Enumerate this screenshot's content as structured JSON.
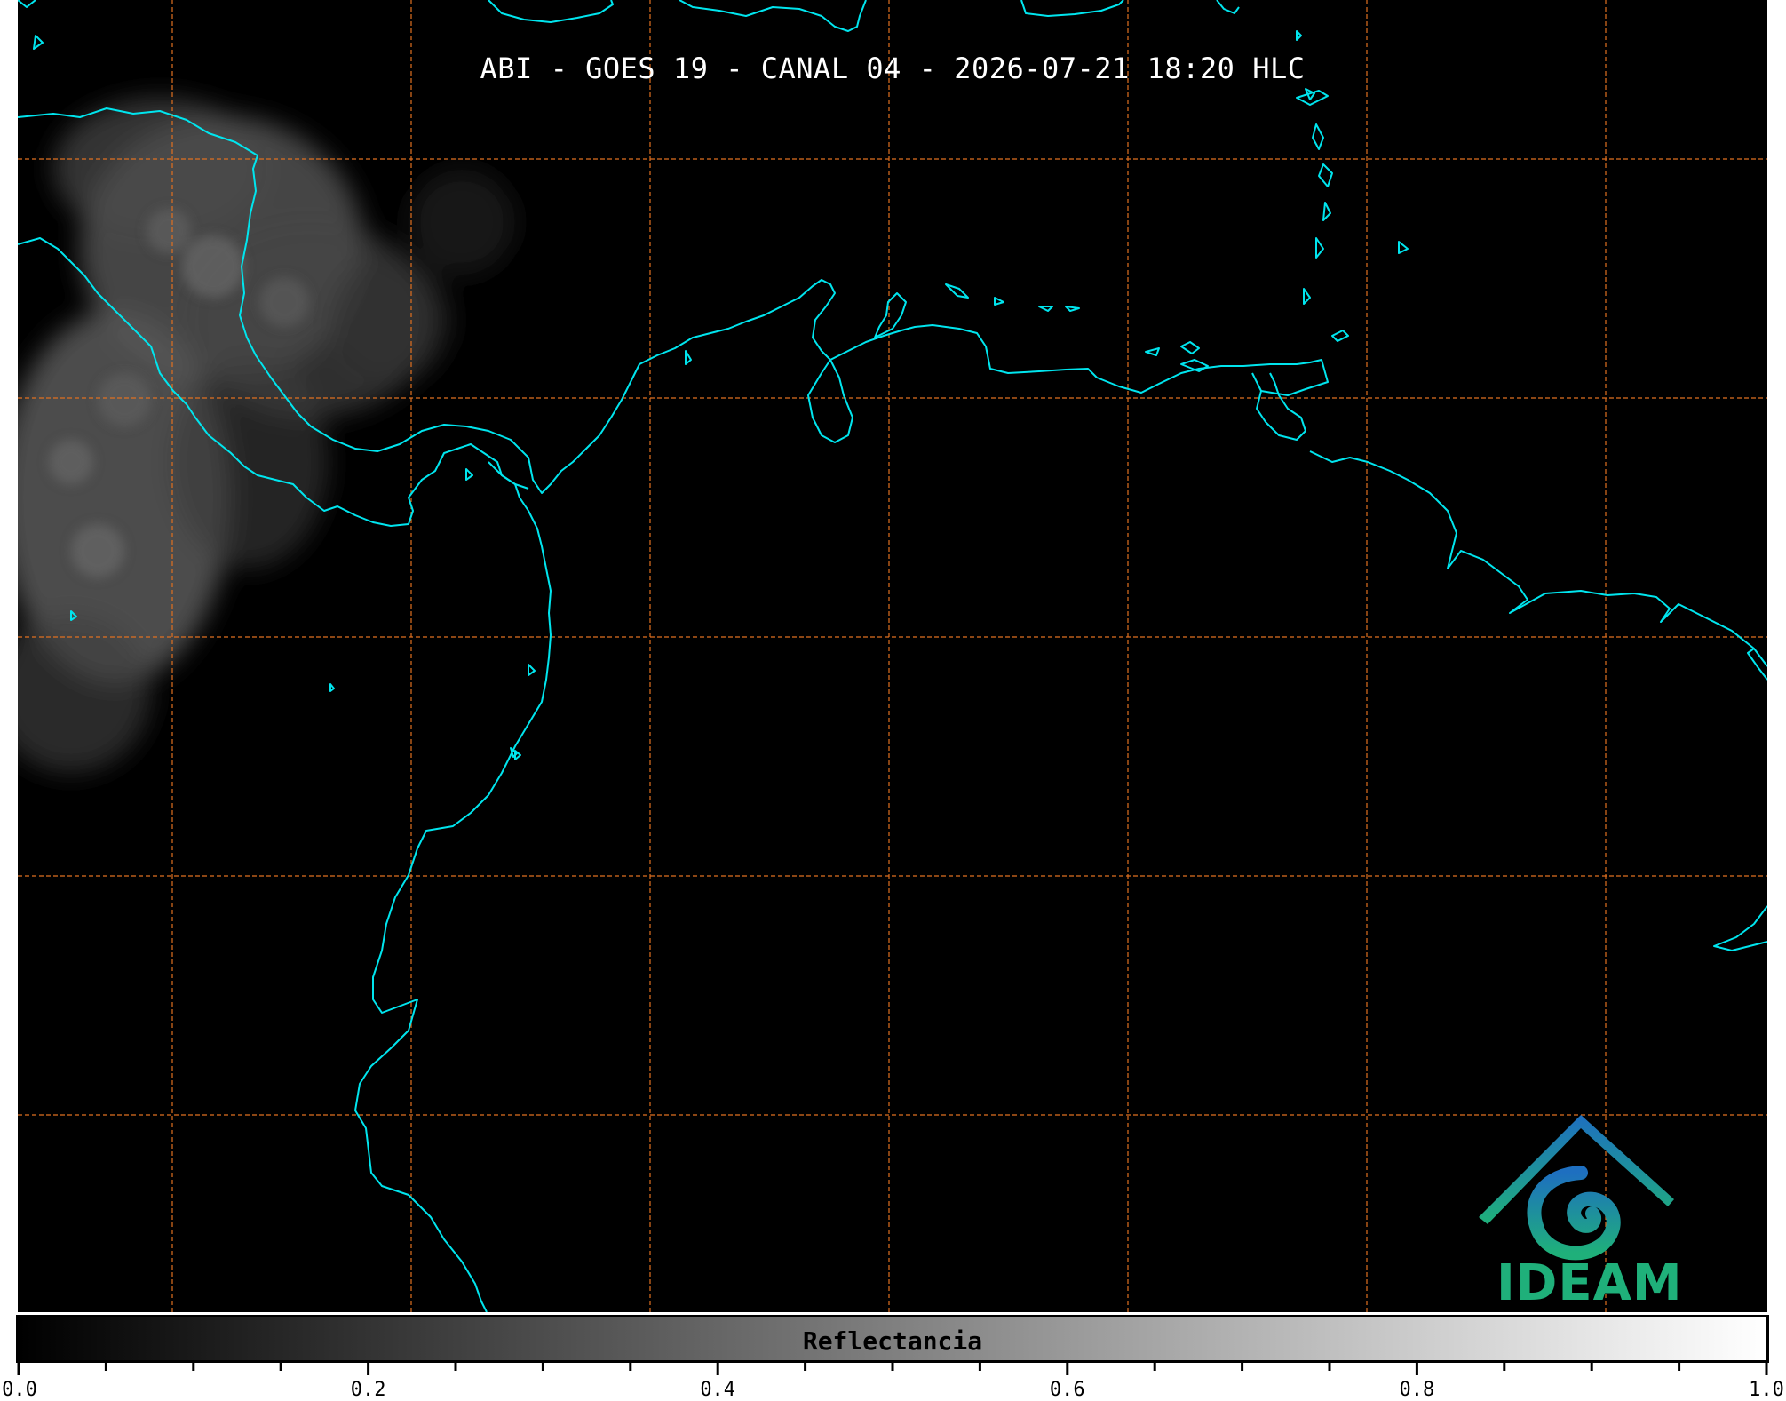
{
  "title": "ABI - GOES 19 - CANAL 04 - 2026-07-21 18:20 HLC",
  "logo": {
    "text": "IDEAM",
    "icon": "ideam-logo-icon"
  },
  "colorbar": {
    "label": "Reflectancia",
    "min": 0.0,
    "max": 1.0,
    "tick_labels": [
      "0.0",
      "0.2",
      "0.4",
      "0.6",
      "0.8",
      "1.0"
    ],
    "gradient_from": "#000000",
    "gradient_to": "#ffffff"
  },
  "colors": {
    "background": "#000000",
    "coastline": "#00e5ee",
    "gridline": "#e07020",
    "title_text": "#ffffff",
    "logo_green": "#1fb07a",
    "logo_teal": "#1e88b5"
  },
  "map": {
    "layers": [
      "cloud-reflectance",
      "coastlines",
      "lat-lon-grid"
    ]
  }
}
